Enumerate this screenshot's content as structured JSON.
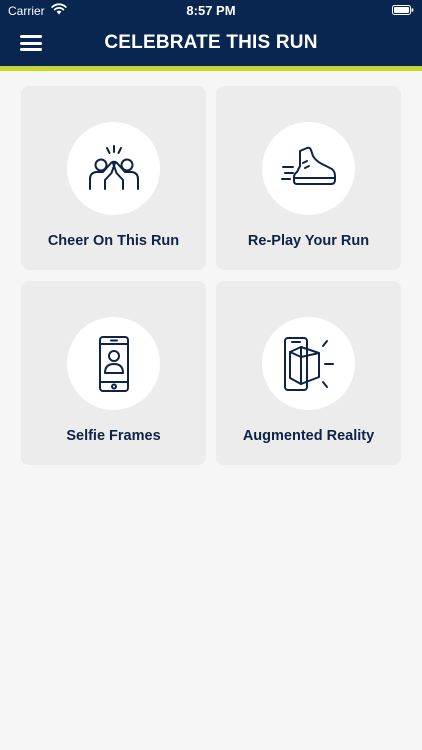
{
  "status_bar": {
    "carrier": "Carrier",
    "time": "8:57 PM"
  },
  "header": {
    "title": "CELEBRATE THIS RUN",
    "menu_icon": "hamburger-menu-icon"
  },
  "colors": {
    "header_bg": "#08264f",
    "accent": "#c6d630",
    "tile_bg": "#ececec",
    "text": "#0d2448"
  },
  "tiles": [
    {
      "label": "Cheer On This Run",
      "icon": "high-five-icon"
    },
    {
      "label": "Re-Play Your Run",
      "icon": "running-shoe-icon"
    },
    {
      "label": "Selfie Frames",
      "icon": "phone-selfie-icon"
    },
    {
      "label": "Augmented Reality",
      "icon": "augmented-reality-icon"
    }
  ]
}
